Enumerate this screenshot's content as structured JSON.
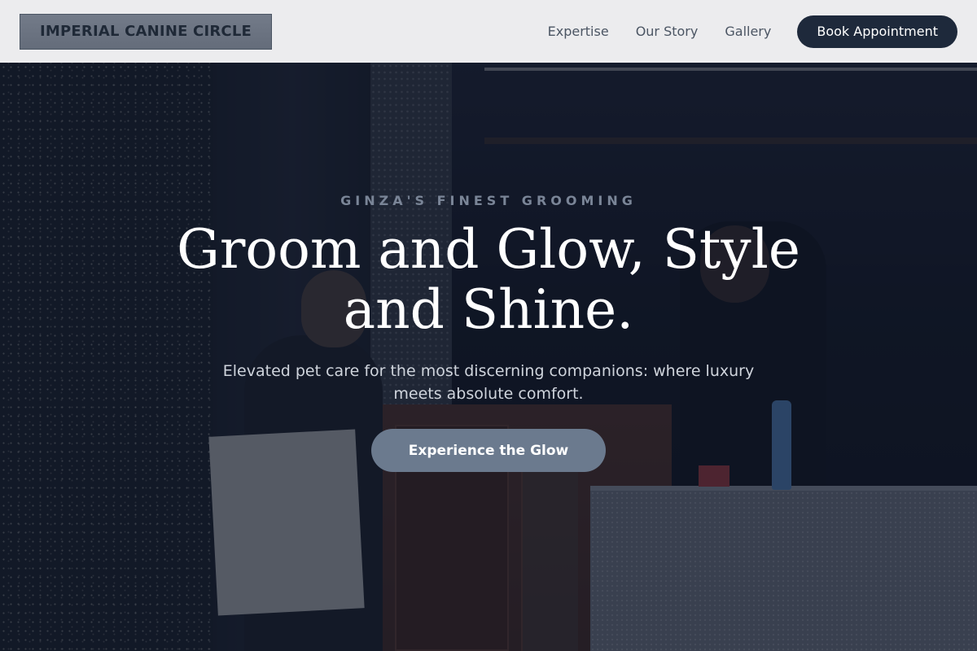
{
  "header": {
    "logo_text": "IMPERIAL CANINE CIRCLE",
    "nav_links": [
      "Expertise",
      "Our Story",
      "Gallery"
    ],
    "cta_label": "Book Appointment"
  },
  "hero": {
    "eyebrow": "GINZA'S FINEST GROOMING",
    "headline": "Groom and Glow, Style and Shine.",
    "subtext": "Elevated pet care for the most discerning companions: where luxury meets absolute comfort.",
    "cta_label": "Experience the Glow"
  },
  "colors": {
    "header_bg": "#ececee",
    "logo_bg": "#6b7280",
    "book_button_bg": "#1e293b",
    "hero_overlay": "#0f172a",
    "cta_bg": "#6b7a8e",
    "eyebrow_text": "#7a8597"
  }
}
